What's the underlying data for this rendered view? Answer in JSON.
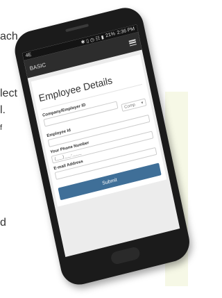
{
  "background": {
    "text_lines": [
      "ach",
      "lect",
      "l.",
      "f",
      "d"
    ],
    "panel_color": "#f6f8e6"
  },
  "status_bar": {
    "left": "4E",
    "icons": "✱ ▯ ◷ ☷ ▮",
    "battery": "21%",
    "time": "2:36 PM"
  },
  "app_bar": {
    "title": "BASIC",
    "menu_icon": "hamburger-menu-icon"
  },
  "form": {
    "title": "Employee Details",
    "company_label": "Company/Employer ID",
    "company_value": "",
    "company_select": "Comp",
    "employee_label": "Employee Id",
    "employee_value": "",
    "phone_label": "Your Phone Number",
    "phone_placeholder": "(___)___-____",
    "email_label": "E-mail Address",
    "email_value": "",
    "submit_label": "Submit",
    "accent_color": "#3f6f98"
  }
}
